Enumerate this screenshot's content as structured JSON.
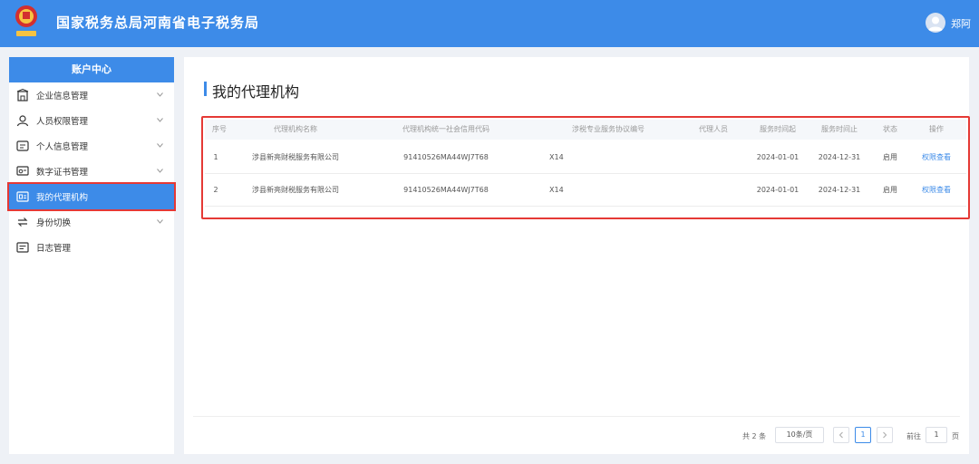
{
  "header": {
    "title": "国家税务总局河南省电子税务局",
    "user_name": "郑阿",
    "emblem_caption": "中国税务"
  },
  "sidebar": {
    "heading": "账户中心",
    "items": [
      {
        "label": "企业信息管理",
        "icon": "building-icon",
        "expandable": true
      },
      {
        "label": "人员权限管理",
        "icon": "user-lock-icon",
        "expandable": true
      },
      {
        "label": "个人信息管理",
        "icon": "id-card-icon",
        "expandable": true
      },
      {
        "label": "数字证书管理",
        "icon": "certificate-icon",
        "expandable": true
      },
      {
        "label": "我的代理机构",
        "icon": "agency-icon",
        "expandable": false,
        "active": true
      },
      {
        "label": "身份切换",
        "icon": "switch-icon",
        "expandable": true
      },
      {
        "label": "日志管理",
        "icon": "log-icon",
        "expandable": false
      }
    ]
  },
  "main": {
    "title": "我的代理机构",
    "table": {
      "headers": [
        "序号",
        "代理机构名称",
        "代理机构统一社会信用代码",
        "涉税专业服务协议编号",
        "代理人员",
        "服务时间起",
        "服务时间止",
        "状态",
        "操作"
      ],
      "rows": [
        [
          "1",
          "涉县新亮财税服务有限公司",
          "91410526MA44WJ7T68",
          "X14",
          "",
          "2024-01-01",
          "2024-12-31",
          "启用",
          "权限查看"
        ],
        [
          "2",
          "涉县新亮财税服务有限公司",
          "91410526MA44WJ7T68",
          "X14",
          "",
          "2024-01-01",
          "2024-12-31",
          "启用",
          "权限查看"
        ]
      ]
    },
    "pagination": {
      "total_text": "共 2 条",
      "page_size": "10条/页",
      "current_page": "1",
      "goto_label": "前往",
      "goto_value": "1",
      "page_unit": "页"
    }
  },
  "colors": {
    "primary": "#3d8be8",
    "highlight": "#e53935"
  }
}
